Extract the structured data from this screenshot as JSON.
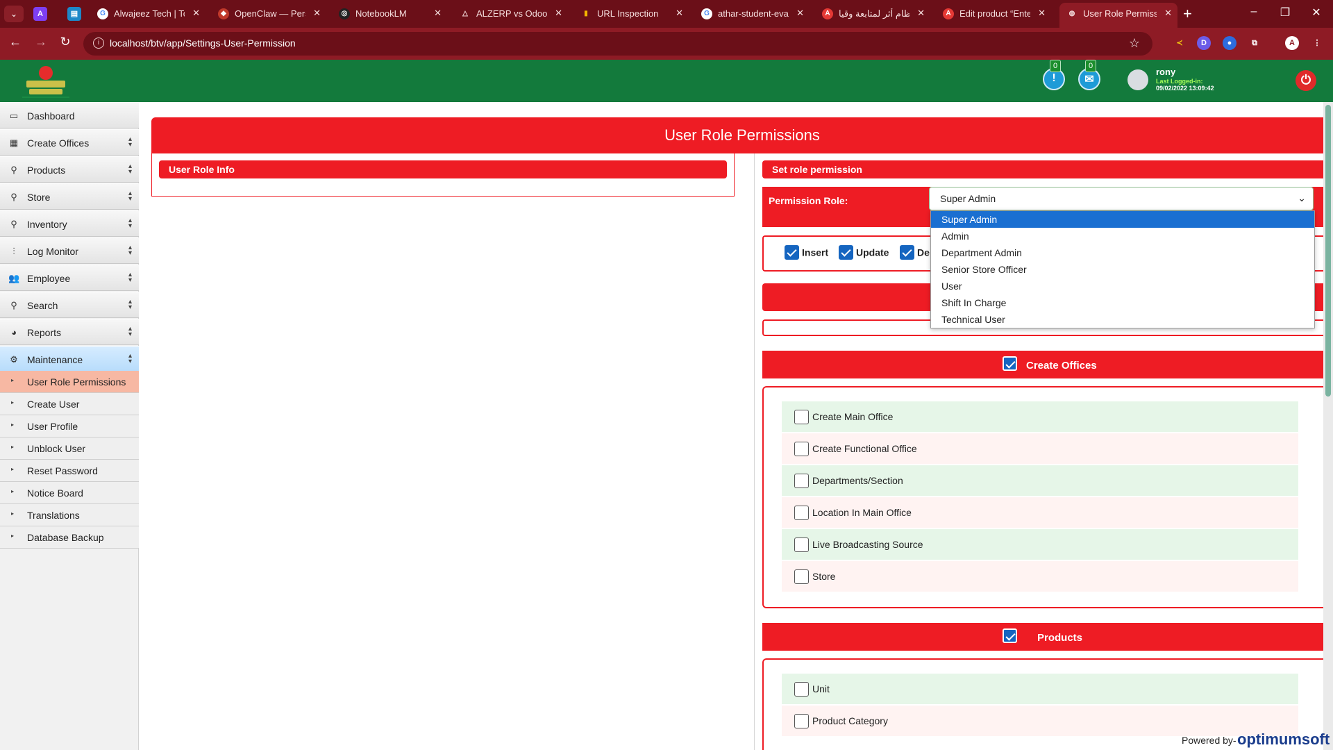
{
  "browser": {
    "tabs": [
      {
        "title": "Alwajeez Tech | Top",
        "icon": "google-icon"
      },
      {
        "title": "OpenClaw — Perso",
        "icon": "claw-icon"
      },
      {
        "title": "NotebookLM",
        "icon": "notebooklm-icon"
      },
      {
        "title": "ALZERP vs Odoo: C",
        "icon": "alzerp-icon"
      },
      {
        "title": "URL Inspection",
        "icon": "search-console-icon"
      },
      {
        "title": "athar-student-evalu",
        "icon": "google-icon"
      },
      {
        "title": "نظام أثر لمتابعة وقيا",
        "icon": "athar-icon"
      },
      {
        "title": "Edit product “Enter",
        "icon": "athar-icon"
      },
      {
        "title": "User Role Permissio",
        "icon": "globe-icon"
      }
    ],
    "url": "localhost/btv/app/Settings-User-Permission"
  },
  "header": {
    "notifications": [
      {
        "name": "info-notification",
        "count": "0",
        "symbol": "!"
      },
      {
        "name": "mail-notification",
        "count": "0",
        "symbol": "✉"
      }
    ],
    "user": {
      "name": "rony",
      "last_login_label": "Last Logged-in:",
      "last_login_value": "09/02/2022 13:09:42"
    }
  },
  "sidebar": {
    "items": [
      {
        "label": "Dashboard",
        "icon": "monitor-icon",
        "expandable": false
      },
      {
        "label": "Create Offices",
        "icon": "building-icon",
        "expandable": true
      },
      {
        "label": "Products",
        "icon": "flask-icon",
        "expandable": true
      },
      {
        "label": "Store",
        "icon": "search-icon",
        "expandable": true
      },
      {
        "label": "Inventory",
        "icon": "flask-icon",
        "expandable": true
      },
      {
        "label": "Log Monitor",
        "icon": "sliders-icon",
        "expandable": true
      },
      {
        "label": "Employee",
        "icon": "users-icon",
        "expandable": true
      },
      {
        "label": "Search",
        "icon": "search-icon",
        "expandable": true
      },
      {
        "label": "Reports",
        "icon": "pie-chart-icon",
        "expandable": true
      },
      {
        "label": "Maintenance",
        "icon": "gear-icon",
        "expandable": true,
        "active": true
      }
    ],
    "sub_items": [
      {
        "label": "User Role Permissions",
        "active": true
      },
      {
        "label": "Create User"
      },
      {
        "label": "User Profile"
      },
      {
        "label": "Unblock User"
      },
      {
        "label": "Reset Password"
      },
      {
        "label": "Notice Board"
      },
      {
        "label": "Translations"
      },
      {
        "label": "Database Backup"
      }
    ]
  },
  "main": {
    "title": "User Role Permissions",
    "role_info_heading": "User Role Info",
    "set_permission_heading": "Set role permission",
    "permission_role_label": "Permission Role:",
    "permission_role_value": "Super Admin",
    "crud": [
      {
        "label": "Insert",
        "checked": true
      },
      {
        "label": "Update",
        "checked": true
      },
      {
        "label": "De",
        "checked": true
      }
    ],
    "role_options": [
      "Super Admin",
      "Admin",
      "Department Admin",
      "Senior Store Officer",
      "User",
      "Shift In Charge",
      "Technical User"
    ],
    "sections": [
      {
        "label": "Create Offices",
        "checked": true,
        "items": [
          "Create Main Office",
          "Create Functional Office",
          "Departments/Section",
          "Location In Main Office",
          "Live Broadcasting Source",
          "Store"
        ]
      },
      {
        "label": "Products",
        "checked": true,
        "items": [
          "Unit",
          "Product Category"
        ]
      }
    ]
  },
  "footer": {
    "powered_by": "Powered by-",
    "brand": "optimumsoft"
  },
  "colors": {
    "accent_red": "#ee1c24",
    "header_green": "#137a3c",
    "browser_maroon": "#8e1b25",
    "selected_blue": "#1a6fd1"
  }
}
